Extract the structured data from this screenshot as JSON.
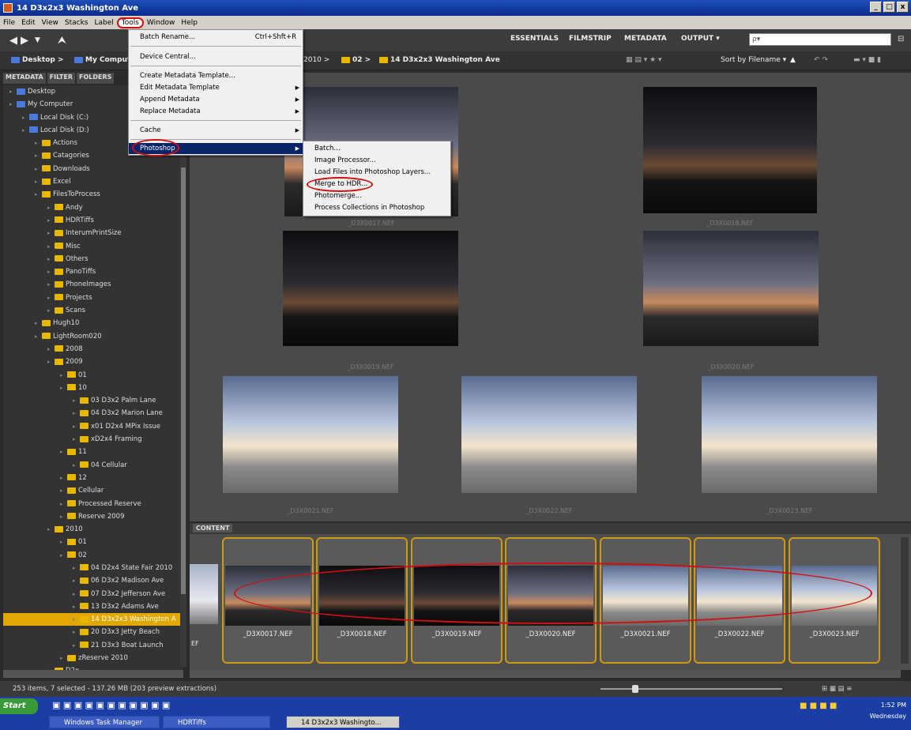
{
  "window": {
    "title": "14 D3x2x3 Washington Ave",
    "controls": [
      "_",
      "□",
      "x"
    ]
  },
  "menubar": [
    "File",
    "Edit",
    "View",
    "Stacks",
    "Label",
    "Tools",
    "Window",
    "Help"
  ],
  "workspaces": [
    "ESSENTIALS",
    "FILMSTRIP",
    "METADATA",
    "OUTPUT ▾"
  ],
  "search": {
    "placeholder": "ρ▾"
  },
  "path": {
    "left": [
      "Desktop >",
      "My Computer"
    ],
    "right": [
      "2010 >",
      "02 >",
      "14 D3x2x3 Washington Ave"
    ],
    "sort": "Sort by Filename ▾"
  },
  "panel_tabs": [
    "METADATA",
    "FILTER",
    "FOLDERS"
  ],
  "tree": [
    {
      "label": "Desktop",
      "indent": 0
    },
    {
      "label": "My Computer",
      "indent": 0
    },
    {
      "label": "Local Disk (C:)",
      "indent": 1
    },
    {
      "label": "Local Disk (D:)",
      "indent": 1
    },
    {
      "label": "Actions",
      "indent": 2
    },
    {
      "label": "Catagories",
      "indent": 2
    },
    {
      "label": "Downloads",
      "indent": 2
    },
    {
      "label": "Excel",
      "indent": 2
    },
    {
      "label": "FilesToProcess",
      "indent": 2
    },
    {
      "label": "Andy",
      "indent": 3
    },
    {
      "label": "HDRTiffs",
      "indent": 3
    },
    {
      "label": "InterumPrintSize",
      "indent": 3
    },
    {
      "label": "Misc",
      "indent": 3
    },
    {
      "label": "Others",
      "indent": 3
    },
    {
      "label": "PanoTiffs",
      "indent": 3
    },
    {
      "label": "PhoneImages",
      "indent": 3
    },
    {
      "label": "Projects",
      "indent": 3
    },
    {
      "label": "Scans",
      "indent": 3
    },
    {
      "label": "Hugh10",
      "indent": 2
    },
    {
      "label": "LightRoom020",
      "indent": 2
    },
    {
      "label": "2008",
      "indent": 3
    },
    {
      "label": "2009",
      "indent": 3
    },
    {
      "label": "01",
      "indent": 4
    },
    {
      "label": "10",
      "indent": 4
    },
    {
      "label": "03 D3x2 Palm Lane",
      "indent": 5
    },
    {
      "label": "04 D3x2 Marion Lane",
      "indent": 5
    },
    {
      "label": "x01 D2x4 MPix Issue",
      "indent": 5
    },
    {
      "label": "xD2x4 Framing",
      "indent": 5
    },
    {
      "label": "11",
      "indent": 4
    },
    {
      "label": "04 Cellular",
      "indent": 5
    },
    {
      "label": "12",
      "indent": 4
    },
    {
      "label": "Cellular",
      "indent": 4
    },
    {
      "label": "Processed Reserve",
      "indent": 4
    },
    {
      "label": "Reserve 2009",
      "indent": 4
    },
    {
      "label": "2010",
      "indent": 3
    },
    {
      "label": "01",
      "indent": 4
    },
    {
      "label": "02",
      "indent": 4
    },
    {
      "label": "04 D2x4 State Fair 2010",
      "indent": 5
    },
    {
      "label": "06 D3x2 Madison Ave",
      "indent": 5
    },
    {
      "label": "07 D3x2 Jefferson Ave",
      "indent": 5
    },
    {
      "label": "13 D3x2 Adams Ave",
      "indent": 5
    },
    {
      "label": "14 D3x2x3 Washington A",
      "indent": 5
    },
    {
      "label": "20 D3x3 Jetty Beach",
      "indent": 5
    },
    {
      "label": "21 D3x3 Boat Launch",
      "indent": 5
    },
    {
      "label": "zReserve 2010",
      "indent": 4
    },
    {
      "label": "D2x",
      "indent": 3
    }
  ],
  "preview_captions": [
    "_D3X0017.NEF",
    "_D3X0018.NEF",
    "_D3X0019.NEF",
    "_D3X0020.NEF",
    "_D3X0021.NEF",
    "_D3X0022.NEF",
    "_D3X0023.NEF"
  ],
  "content_tab": "CONTENT",
  "filmstrip": [
    "_D3X0017.NEF",
    "_D3X0018.NEF",
    "_D3X0019.NEF",
    "_D3X0020.NEF",
    "_D3X0021.NEF",
    "_D3X0022.NEF",
    "_D3X0023.NEF"
  ],
  "filmstrip_prev": "EF",
  "status": "253 items, 7 selected - 137.26 MB (203 preview extractions)",
  "tools_menu": [
    {
      "label": "Batch Rename...",
      "shortcut": "Ctrl+Shft+R"
    },
    {
      "label": "Device Central..."
    },
    {
      "label": "Create Metadata Template..."
    },
    {
      "label": "Edit Metadata Template",
      "submenu": true
    },
    {
      "label": "Append Metadata",
      "submenu": true
    },
    {
      "label": "Replace Metadata",
      "submenu": true
    },
    {
      "label": "Cache",
      "submenu": true
    },
    {
      "label": "Photoshop",
      "submenu": true
    }
  ],
  "photoshop_menu": [
    "Batch...",
    "Image Processor...",
    "Load Files into Photoshop Layers...",
    "Merge to HDR...",
    "Photomerge...",
    "Process Collections in Photoshop"
  ],
  "taskbar": {
    "start": "Start",
    "items": [
      "Windows Task Manager",
      "HDRTiffs",
      "14 D3x2x3 Washingto..."
    ],
    "time": "1:52 PM",
    "day": "Wednesday"
  }
}
